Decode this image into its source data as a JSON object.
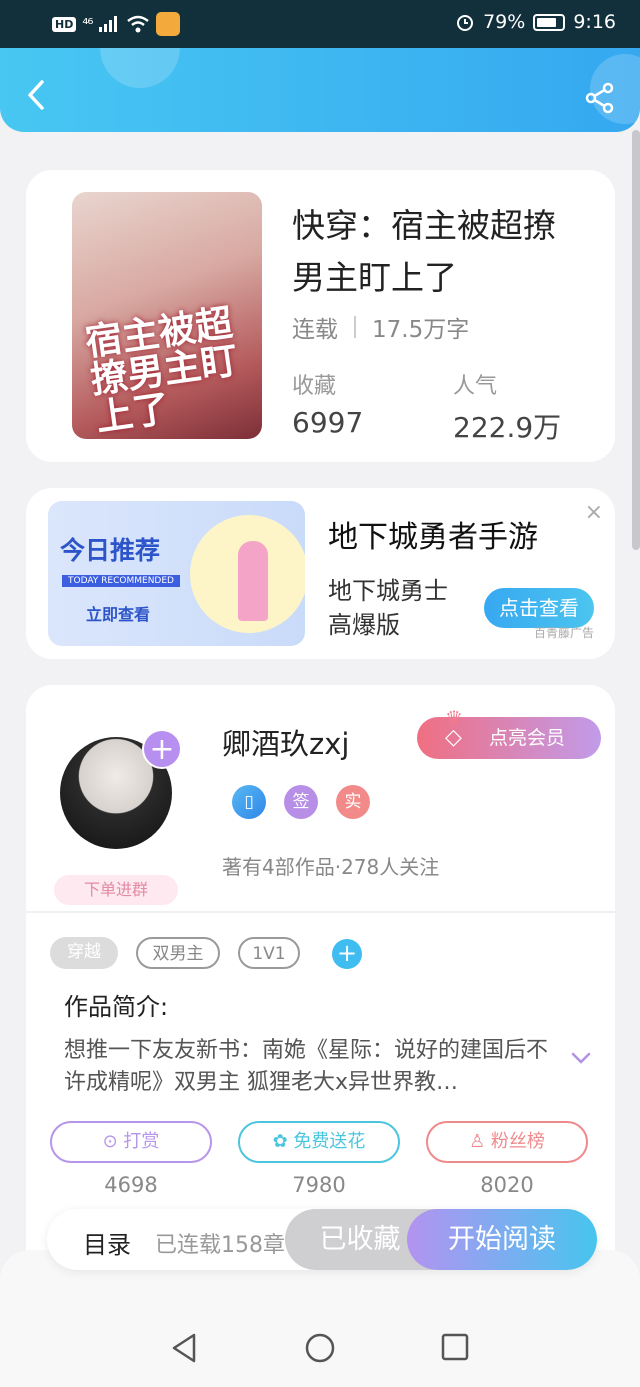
{
  "status_bar": {
    "hd": "HD",
    "signal": "⁴⁶",
    "battery_percent": "79%",
    "battery_level": 0.79,
    "time": "9:16"
  },
  "header": {
    "back_icon": "chevron-left-icon",
    "share_icon": "share-icon"
  },
  "book": {
    "cover_text": "宿主被超撩男主盯上了",
    "title": "快穿：宿主被超撩男主盯上了",
    "status": "连载",
    "word_count": "17.5万字",
    "collect_label": "收藏",
    "collect_value": "6997",
    "popularity_label": "人气",
    "popularity_value": "222.9万"
  },
  "ad": {
    "banner_title": "今日推荐",
    "banner_sub": "TODAY RECOMMENDED",
    "banner_button": "立即查看",
    "title": "地下城勇者手游",
    "description": "地下城勇士高爆版",
    "cta": "点击查看",
    "source": "百青藤广告",
    "close": "×"
  },
  "author": {
    "name": "卿酒玖zxj",
    "follow_plus": "+",
    "group_tag": "下单进群",
    "vip_button": "点亮会员",
    "badges": [
      "",
      "签",
      "实"
    ],
    "stats": "著有4部作品·278人关注"
  },
  "tags": [
    "穿越",
    "双男主",
    "1V1"
  ],
  "tag_add": "+",
  "intro": {
    "title": "作品简介:",
    "text": "想推一下友友新书：南姽《星际：说好的建国后不许成精呢》双男主 狐狸老大x异世界教…"
  },
  "actions": [
    {
      "label": "打赏",
      "count": "4698",
      "icon": "yen-coin-icon",
      "color": "#b695ea"
    },
    {
      "label": "免费送花",
      "count": "7980",
      "icon": "flower-icon",
      "color": "#4cc5df"
    },
    {
      "label": "粉丝榜",
      "count": "8020",
      "icon": "user-ranking-icon",
      "color": "#ef8a8c"
    }
  ],
  "bottom_bar": {
    "toc_label": "目录",
    "toc_count": "已连载158章",
    "collected_label": "已收藏",
    "read_label": "开始阅读"
  },
  "navbar": {
    "back_icon": "triangle-back-icon",
    "home_icon": "circle-home-icon",
    "recents_icon": "square-recents-icon"
  }
}
